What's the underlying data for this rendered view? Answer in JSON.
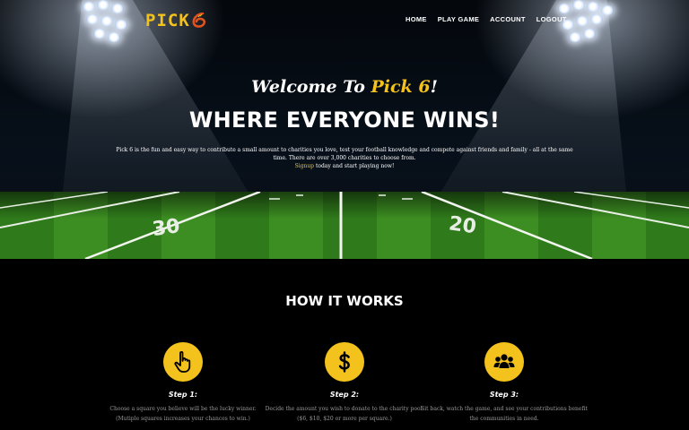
{
  "brand": {
    "logo_text": "PICK",
    "logo_icon": "football-six-icon",
    "accent": "#f4c21c"
  },
  "nav": [
    {
      "label": "HOME"
    },
    {
      "label": "PLAY GAME"
    },
    {
      "label": "ACCOUNT"
    },
    {
      "label": "LOGOUT"
    }
  ],
  "hero": {
    "welcome_prefix": "Welcome To ",
    "welcome_brand": "Pick 6",
    "welcome_suffix": "!",
    "tagline": "WHERE EVERYONE WINS!",
    "intro_text": "Pick 6 is the fun and easy way to contribute a small amount to charities you love, test your football knowledge and compete against friends and family - all at the same time. There are over 3,000 charities to choose from.",
    "signup_link": "Signup",
    "signup_suffix": " today and start playing now!",
    "field_left_number": "30",
    "field_right_number": "20"
  },
  "how_it_works": {
    "title": "HOW IT WORKS",
    "steps": [
      {
        "icon": "pointing-hand-icon",
        "label": "Step 1:",
        "desc": "Choose a square you believe will be the lucky winner. (Mutiple squares increases your chances to win.)"
      },
      {
        "icon": "dollar-icon",
        "label": "Step 2:",
        "desc": "Decide the amount you wish to donate to the charity pool. ($6, $10, $20 or more per square.)"
      },
      {
        "icon": "group-icon",
        "label": "Step 3:",
        "desc": "Sit back, watch the game, and see your contributions benefit the communities in need."
      }
    ]
  }
}
